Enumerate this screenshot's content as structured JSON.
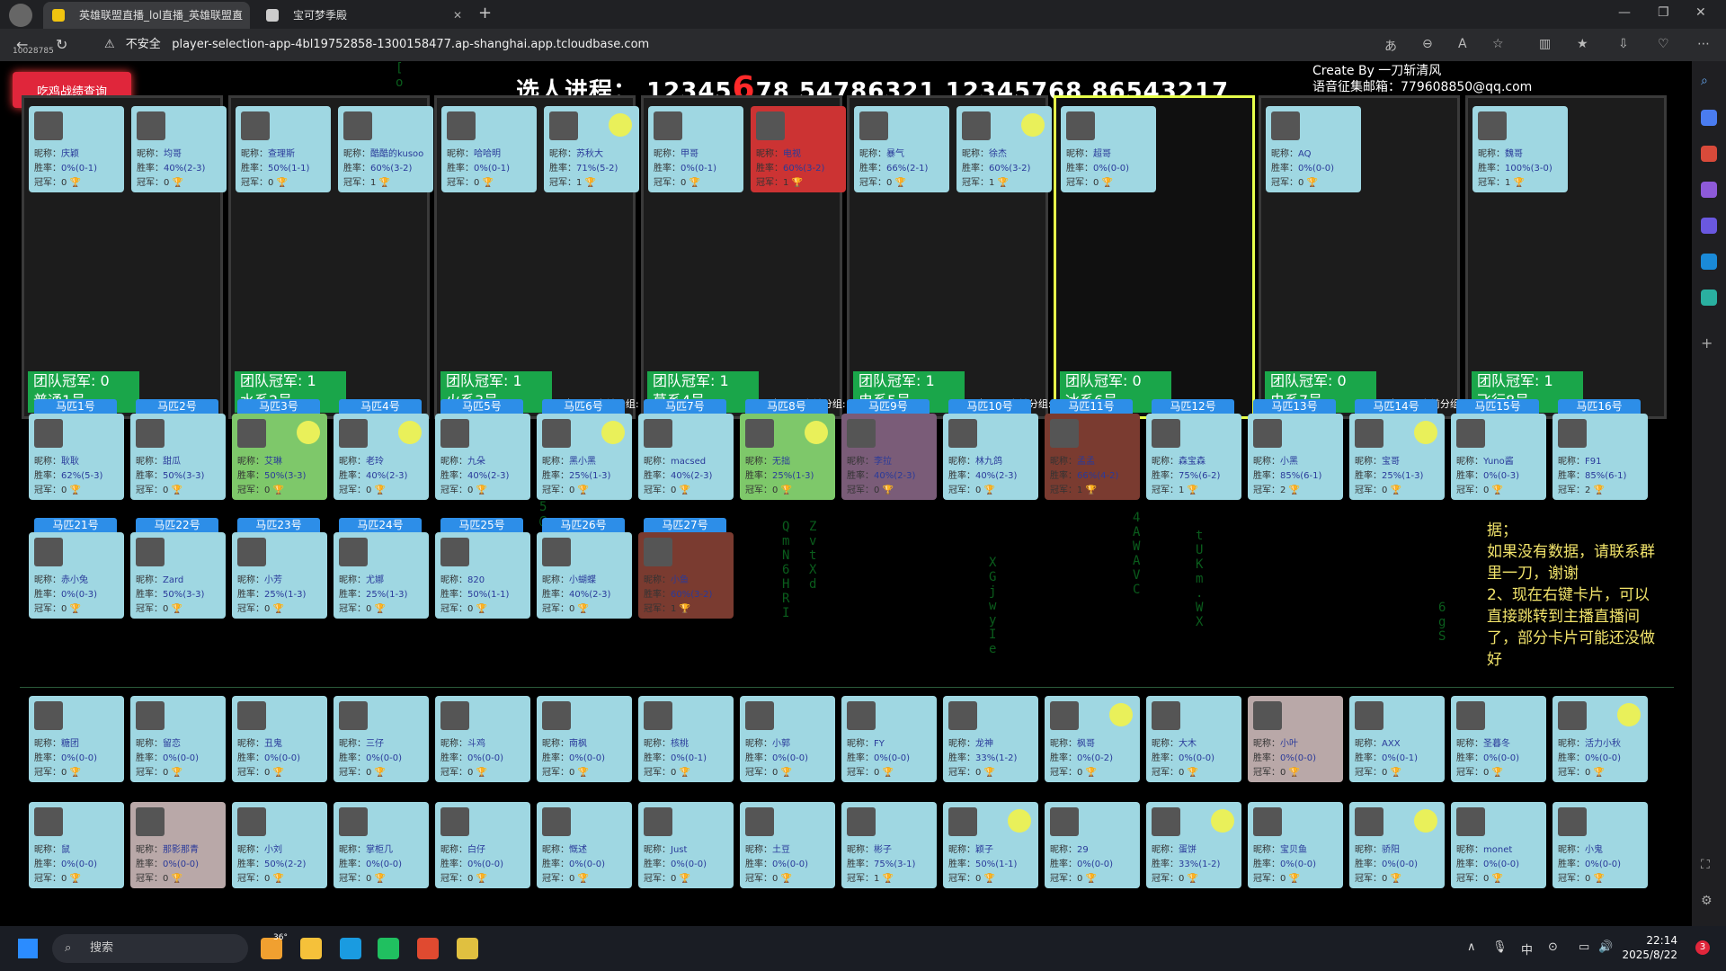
{
  "browser": {
    "tabs": [
      {
        "label": "英雄联盟直播_lol直播_英雄联盟直"
      },
      {
        "label": "宝可梦季殿"
      }
    ],
    "security_label": "不安全",
    "url": "player-selection-app-4bl19752858-1300158477.ap-shanghai.app.tcloudbase.com",
    "overlay_id": "10028785"
  },
  "header": {
    "query_button": "吃鸡战绩查询",
    "progress_label": "选人进程：",
    "progress_a": "12345",
    "progress_red": "6",
    "progress_b": "78 54786321 12345768 86543217",
    "credit_line1": "Create By 一刀斩清风",
    "credit_line2": "语音征集邮箱：779608850@qq.com"
  },
  "labels": {
    "nick": "昵称：",
    "rate": "胜率：",
    "champ": "冠军："
  },
  "teams": [
    {
      "title": "团队冠军: 0",
      "name": "普通1号",
      "sub": "",
      "members": [
        {
          "nick": "庆颖",
          "rate": "0%(0-1)",
          "champ": "0"
        },
        {
          "nick": "均哥",
          "rate": "40%(2-3)",
          "champ": "0"
        }
      ]
    },
    {
      "title": "团队冠军: 1",
      "name": "水系2号",
      "sub": "",
      "members": [
        {
          "nick": "查理斯",
          "rate": "50%(1-1)",
          "champ": "0"
        },
        {
          "nick": "酷酷的kusoo",
          "rate": "60%(3-2)",
          "champ": "1"
        }
      ]
    },
    {
      "title": "团队冠军: 1",
      "name": "火系3号",
      "sub": "roll点: 49 当前分组: A组",
      "members": [
        {
          "nick": "哈哈明",
          "rate": "0%(0-1)",
          "champ": "0"
        },
        {
          "nick": "苏秋大",
          "rate": "71%(5-2)",
          "champ": "1"
        }
      ]
    },
    {
      "title": "团队冠军: 1",
      "name": "草系4号",
      "sub": "roll点: 68 当前分组: B组",
      "members": [
        {
          "nick": "甲哥",
          "rate": "0%(0-1)",
          "champ": "0"
        },
        {
          "nick": "电视",
          "rate": "60%(3-2)",
          "champ": "1"
        }
      ]
    },
    {
      "title": "团队冠军: 1",
      "name": "电系5号",
      "sub": "roll点: 38 当前分组: A组",
      "members": [
        {
          "nick": "暴气",
          "rate": "66%(2-1)",
          "champ": "0"
        },
        {
          "nick": "徐杰",
          "rate": "60%(3-2)",
          "champ": "1"
        }
      ]
    },
    {
      "title": "团队冠军: 0",
      "name": "冰系6号",
      "sub": "",
      "members": [
        {
          "nick": "超哥",
          "rate": "0%(0-0)",
          "champ": "0"
        }
      ]
    },
    {
      "title": "团队冠军: 0",
      "name": "虫系7号",
      "sub": "roll点: 53 当前分组: B组",
      "members": [
        {
          "nick": "AQ",
          "rate": "0%(0-0)",
          "champ": "0"
        }
      ]
    },
    {
      "title": "团队冠军: 1",
      "name": "飞行8号",
      "sub": "",
      "members": [
        {
          "nick": "魏哥",
          "rate": "100%(3-0)",
          "champ": "1"
        }
      ]
    }
  ],
  "horses": [
    {
      "slot": "马匹1号",
      "nick": "耿耿",
      "rate": "62%(5-3)",
      "champ": "0"
    },
    {
      "slot": "马匹2号",
      "nick": "甜瓜",
      "rate": "50%(3-3)",
      "champ": "0"
    },
    {
      "slot": "马匹3号",
      "nick": "艾琳",
      "rate": "50%(3-3)",
      "champ": "0"
    },
    {
      "slot": "马匹4号",
      "nick": "老玲",
      "rate": "40%(2-3)",
      "champ": "0"
    },
    {
      "slot": "马匹5号",
      "nick": "九朵",
      "rate": "40%(2-3)",
      "champ": "0"
    },
    {
      "slot": "马匹6号",
      "nick": "黑小黑",
      "rate": "25%(1-3)",
      "champ": "0"
    },
    {
      "slot": "马匹7号",
      "nick": "macsed",
      "rate": "40%(2-3)",
      "champ": "0"
    },
    {
      "slot": "马匹8号",
      "nick": "无拙",
      "rate": "25%(1-3)",
      "champ": "0"
    },
    {
      "slot": "马匹9号",
      "nick": "李拉",
      "rate": "40%(2-3)",
      "champ": "0"
    },
    {
      "slot": "马匹10号",
      "nick": "林九鸽",
      "rate": "40%(2-3)",
      "champ": "0"
    },
    {
      "slot": "马匹11号",
      "nick": "孟孟",
      "rate": "66%(4-2)",
      "champ": "1"
    },
    {
      "slot": "马匹12号",
      "nick": "森宝森",
      "rate": "75%(6-2)",
      "champ": "1"
    },
    {
      "slot": "马匹13号",
      "nick": "小黑",
      "rate": "85%(6-1)",
      "champ": "2"
    },
    {
      "slot": "马匹14号",
      "nick": "宝哥",
      "rate": "25%(1-3)",
      "champ": "0"
    },
    {
      "slot": "马匹15号",
      "nick": "Yuno酱",
      "rate": "0%(0-3)",
      "champ": "0"
    },
    {
      "slot": "马匹16号",
      "nick": "F91",
      "rate": "85%(6-1)",
      "champ": "2"
    },
    {
      "slot": "马匹21号",
      "nick": "赤小兔",
      "rate": "0%(0-3)",
      "champ": "0"
    },
    {
      "slot": "马匹22号",
      "nick": "Zard",
      "rate": "50%(3-3)",
      "champ": "0"
    },
    {
      "slot": "马匹23号",
      "nick": "小芳",
      "rate": "25%(1-3)",
      "champ": "0"
    },
    {
      "slot": "马匹24号",
      "nick": "尤娜",
      "rate": "25%(1-3)",
      "champ": "0"
    },
    {
      "slot": "马匹25号",
      "nick": "820",
      "rate": "50%(1-1)",
      "champ": "0"
    },
    {
      "slot": "马匹26号",
      "nick": "小蝴蝶",
      "rate": "40%(2-3)",
      "champ": "0"
    },
    {
      "slot": "马匹27号",
      "nick": "小鱼",
      "rate": "60%(3-2)",
      "champ": "1"
    }
  ],
  "pool_row1": [
    {
      "nick": "糖团",
      "rate": "0%(0-0)",
      "champ": "0"
    },
    {
      "nick": "留恋",
      "rate": "0%(0-0)",
      "champ": "0"
    },
    {
      "nick": "丑鬼",
      "rate": "0%(0-0)",
      "champ": "0"
    },
    {
      "nick": "三仔",
      "rate": "0%(0-0)",
      "champ": "0"
    },
    {
      "nick": "斗鸡",
      "rate": "0%(0-0)",
      "champ": "0"
    },
    {
      "nick": "南枫",
      "rate": "0%(0-0)",
      "champ": "0"
    },
    {
      "nick": "核桃",
      "rate": "0%(0-1)",
      "champ": "0"
    },
    {
      "nick": "小郭",
      "rate": "0%(0-0)",
      "champ": "0"
    },
    {
      "nick": "FY",
      "rate": "0%(0-0)",
      "champ": "0"
    },
    {
      "nick": "龙神",
      "rate": "33%(1-2)",
      "champ": "0"
    },
    {
      "nick": "枫哥",
      "rate": "0%(0-2)",
      "champ": "0"
    },
    {
      "nick": "大木",
      "rate": "0%(0-0)",
      "champ": "0"
    },
    {
      "nick": "小叶",
      "rate": "0%(0-0)",
      "champ": "0"
    },
    {
      "nick": "AXX",
      "rate": "0%(0-1)",
      "champ": "0"
    },
    {
      "nick": "圣暮冬",
      "rate": "0%(0-0)",
      "champ": "0"
    },
    {
      "nick": "活力小秋",
      "rate": "0%(0-0)",
      "champ": "0"
    }
  ],
  "pool_row2": [
    {
      "nick": "鼠",
      "rate": "0%(0-0)",
      "champ": "0"
    },
    {
      "nick": "那影那青",
      "rate": "0%(0-0)",
      "champ": "0"
    },
    {
      "nick": "小刘",
      "rate": "50%(2-2)",
      "champ": "0"
    },
    {
      "nick": "掌柜几",
      "rate": "0%(0-0)",
      "champ": "0"
    },
    {
      "nick": "白仔",
      "rate": "0%(0-0)",
      "champ": "0"
    },
    {
      "nick": "慨述",
      "rate": "0%(0-0)",
      "champ": "0"
    },
    {
      "nick": "Just",
      "rate": "0%(0-0)",
      "champ": "0"
    },
    {
      "nick": "土豆",
      "rate": "0%(0-0)",
      "champ": "0"
    },
    {
      "nick": "彬子",
      "rate": "75%(3-1)",
      "champ": "1"
    },
    {
      "nick": "颖子",
      "rate": "50%(1-1)",
      "champ": "0"
    },
    {
      "nick": "29",
      "rate": "0%(0-0)",
      "champ": "0"
    },
    {
      "nick": "蛋饼",
      "rate": "33%(1-2)",
      "champ": "0"
    },
    {
      "nick": "宝贝鱼",
      "rate": "0%(0-0)",
      "champ": "0"
    },
    {
      "nick": "骄阳",
      "rate": "0%(0-0)",
      "champ": "0"
    },
    {
      "nick": "monet",
      "rate": "0%(0-0)",
      "champ": "0"
    },
    {
      "nick": "小鬼",
      "rate": "0%(0-0)",
      "champ": "0"
    }
  ],
  "note": "据；\n如果没有数据，请联系群里一刀，谢谢\n2、现在右键卡片，可以直接跳转到主播直播间了，部分卡片可能还没做好",
  "taskbar": {
    "search": "搜索",
    "weather": "36°",
    "ime": "中",
    "time": "22:14",
    "date": "2025/8/22",
    "badge": "3"
  },
  "colors": {
    "accent_green": "#1aa64a",
    "slot_blue": "#2d8ee8",
    "card": "#9fd7e2",
    "active_team": "#e6ff4a",
    "danger": "#e0263b"
  }
}
